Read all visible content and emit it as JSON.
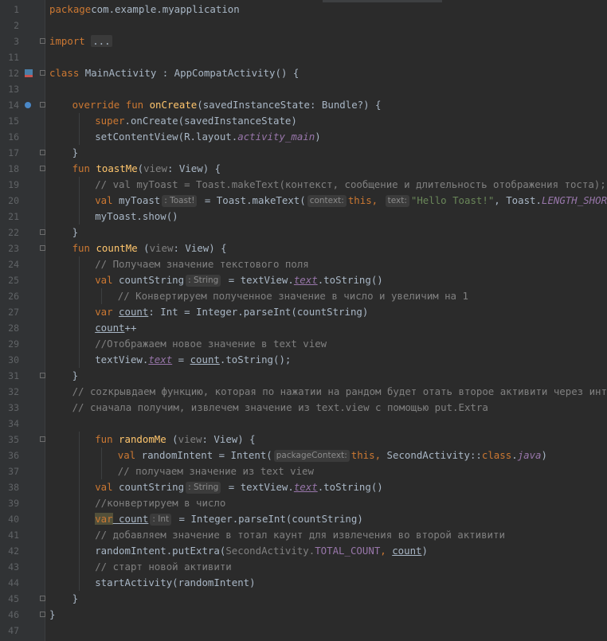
{
  "editor": {
    "lines": [
      {
        "n": "1",
        "indent": 0,
        "tokens": [
          [
            "kw",
            "package"
          ],
          [
            "",
            "com.example.myapplication"
          ]
        ]
      },
      {
        "n": "2",
        "indent": 0,
        "tokens": []
      },
      {
        "n": "3",
        "indent": 0,
        "fold": true,
        "tokens": [
          [
            "kw",
            "import "
          ],
          [
            "fold-box",
            "..."
          ]
        ]
      },
      {
        "n": "11",
        "indent": 0,
        "tokens": []
      },
      {
        "n": "12",
        "indent": 0,
        "marker": "activity",
        "fold": true,
        "tokens": [
          [
            "kw",
            "class "
          ],
          [
            "",
            "MainActivity : AppCompatActivity() {"
          ]
        ]
      },
      {
        "n": "13",
        "indent": 0,
        "tokens": []
      },
      {
        "n": "14",
        "indent": 1,
        "marker": "override",
        "fold": true,
        "tokens": [
          [
            "kw",
            "override fun "
          ],
          [
            "fn",
            "onCreate"
          ],
          [
            "",
            "(savedInstanceState: Bundle?) {"
          ]
        ]
      },
      {
        "n": "15",
        "indent": 2,
        "tokens": [
          [
            "kw",
            "super"
          ],
          [
            "",
            ".onCreate(savedInstanceState)"
          ]
        ]
      },
      {
        "n": "16",
        "indent": 2,
        "tokens": [
          [
            "",
            "setContentView(R.layout."
          ],
          [
            "it",
            "activity_main"
          ],
          [
            "",
            ")"
          ]
        ]
      },
      {
        "n": "17",
        "indent": 1,
        "fold": true,
        "tokens": [
          [
            "",
            "}"
          ]
        ]
      },
      {
        "n": "18",
        "indent": 1,
        "fold": true,
        "tokens": [
          [
            "kw",
            "fun "
          ],
          [
            "fn",
            "toastMe"
          ],
          [
            "",
            "("
          ],
          [
            "dim",
            "view"
          ],
          [
            "",
            ": View) {"
          ]
        ]
      },
      {
        "n": "19",
        "indent": 2,
        "tokens": [
          [
            "cm",
            "// val myToast = Toast.makeText(контекст, сообщение и длительность отображения тоста);"
          ]
        ]
      },
      {
        "n": "20",
        "indent": 2,
        "tokens": [
          [
            "kw",
            "val "
          ],
          [
            "",
            "myToast"
          ],
          [
            "hint",
            ": Toast!"
          ],
          [
            "",
            " = Toast.makeText("
          ],
          [
            "hint",
            "context:"
          ],
          [
            "kw",
            "this, "
          ],
          [
            "hint",
            "text:"
          ],
          [
            "str",
            "\"Hello Toast!\""
          ],
          [
            "",
            ", Toast."
          ],
          [
            "it",
            "LENGTH_SHORT"
          ],
          [
            "",
            ")"
          ]
        ]
      },
      {
        "n": "21",
        "indent": 2,
        "tokens": [
          [
            "",
            "myToast.show()"
          ]
        ]
      },
      {
        "n": "22",
        "indent": 1,
        "fold": true,
        "tokens": [
          [
            "",
            "}"
          ]
        ]
      },
      {
        "n": "23",
        "indent": 1,
        "fold": true,
        "tokens": [
          [
            "kw",
            "fun "
          ],
          [
            "fn",
            "countMe "
          ],
          [
            "",
            "("
          ],
          [
            "dim",
            "view"
          ],
          [
            "",
            ": View) {"
          ]
        ]
      },
      {
        "n": "24",
        "indent": 2,
        "tokens": [
          [
            "cm",
            "// Получаем значение текстового поля"
          ]
        ]
      },
      {
        "n": "25",
        "indent": 2,
        "tokens": [
          [
            "kw",
            "val "
          ],
          [
            "",
            "countString"
          ],
          [
            "hint",
            ": String"
          ],
          [
            "",
            " = textView."
          ],
          [
            "prop",
            "text"
          ],
          [
            "",
            ".toString()"
          ]
        ]
      },
      {
        "n": "26",
        "indent": 3,
        "tokens": [
          [
            "cm",
            "// Конвертируем полученное значение в число и увеличим на 1"
          ]
        ]
      },
      {
        "n": "27",
        "indent": 2,
        "tokens": [
          [
            "kw",
            "var "
          ],
          [
            "ul",
            "count"
          ],
          [
            "",
            ": Int = Integer.parseInt(countString)"
          ]
        ]
      },
      {
        "n": "28",
        "indent": 2,
        "tokens": [
          [
            "ul",
            "count"
          ],
          [
            "",
            "++"
          ]
        ]
      },
      {
        "n": "29",
        "indent": 2,
        "tokens": [
          [
            "cm",
            "//Отображаем новое значение в text view"
          ]
        ]
      },
      {
        "n": "30",
        "indent": 2,
        "tokens": [
          [
            "",
            "textView."
          ],
          [
            "prop",
            "text"
          ],
          [
            "",
            " = "
          ],
          [
            "ul",
            "count"
          ],
          [
            "",
            ".toString();"
          ]
        ]
      },
      {
        "n": "31",
        "indent": 1,
        "fold": true,
        "tokens": [
          [
            "",
            "}"
          ]
        ]
      },
      {
        "n": "32",
        "indent": 1,
        "tokens": [
          [
            "cm",
            "// сozкрывдаем функцию, которая по нажатии на рандом будет отать второе активити через интент"
          ]
        ]
      },
      {
        "n": "33",
        "indent": 1,
        "tokens": [
          [
            "cm",
            "// сначала получим, извлечем значение из text.view с помощью put.Extra"
          ]
        ]
      },
      {
        "n": "34",
        "indent": 1,
        "tokens": []
      },
      {
        "n": "35",
        "indent": 2,
        "fold": true,
        "tokens": [
          [
            "kw",
            "fun "
          ],
          [
            "fn",
            "randomMe "
          ],
          [
            "",
            "("
          ],
          [
            "dim",
            "view"
          ],
          [
            "",
            ": View) {"
          ]
        ]
      },
      {
        "n": "36",
        "indent": 3,
        "tokens": [
          [
            "kw",
            "val "
          ],
          [
            "",
            "randomIntent = Intent("
          ],
          [
            "hint",
            "packageContext:"
          ],
          [
            "kw",
            "this, "
          ],
          [
            "",
            "SecondActivity::"
          ],
          [
            "kw",
            "class"
          ],
          [
            "",
            "."
          ],
          [
            "it",
            "java"
          ],
          [
            "",
            ")"
          ]
        ]
      },
      {
        "n": "37",
        "indent": 3,
        "tokens": [
          [
            "cm",
            "// получаем значение из text view"
          ]
        ]
      },
      {
        "n": "38",
        "indent": 2,
        "tokens": [
          [
            "kw",
            "val "
          ],
          [
            "",
            "countString"
          ],
          [
            "hint",
            ": String"
          ],
          [
            "",
            " = textView."
          ],
          [
            "prop",
            "text"
          ],
          [
            "",
            ".toString()"
          ]
        ]
      },
      {
        "n": "39",
        "indent": 2,
        "tokens": [
          [
            "cm",
            "//конвертируем в число"
          ]
        ]
      },
      {
        "n": "40",
        "indent": 2,
        "tokens": [
          [
            "kw var-hl",
            "var"
          ],
          [
            "",
            ""
          ],
          [
            "ul",
            " count"
          ],
          [
            "hint",
            ": Int"
          ],
          [
            "",
            " = Integer.parseInt(countString)"
          ]
        ]
      },
      {
        "n": "41",
        "indent": 2,
        "tokens": [
          [
            "cm",
            "// добавляем значение в тотал каунт для извлечения во второй активити"
          ]
        ]
      },
      {
        "n": "42",
        "indent": 2,
        "tokens": [
          [
            "",
            "randomIntent.putExtra("
          ],
          [
            "dim",
            "SecondActivity."
          ],
          [
            "pv",
            "TOTAL_COUNT"
          ],
          [
            "kw",
            ", "
          ],
          [
            "ul",
            "count"
          ],
          [
            "",
            ")"
          ]
        ]
      },
      {
        "n": "43",
        "indent": 2,
        "tokens": [
          [
            "cm",
            "// старт новой активити"
          ]
        ]
      },
      {
        "n": "44",
        "indent": 2,
        "tokens": [
          [
            "",
            "startActivity(randomIntent)"
          ]
        ]
      },
      {
        "n": "45",
        "indent": 1,
        "fold": true,
        "tokens": [
          [
            "",
            "}"
          ]
        ]
      },
      {
        "n": "46",
        "indent": 0,
        "fold": true,
        "tokens": [
          [
            "",
            "}"
          ]
        ]
      },
      {
        "n": "47",
        "indent": 0,
        "tokens": []
      }
    ]
  }
}
